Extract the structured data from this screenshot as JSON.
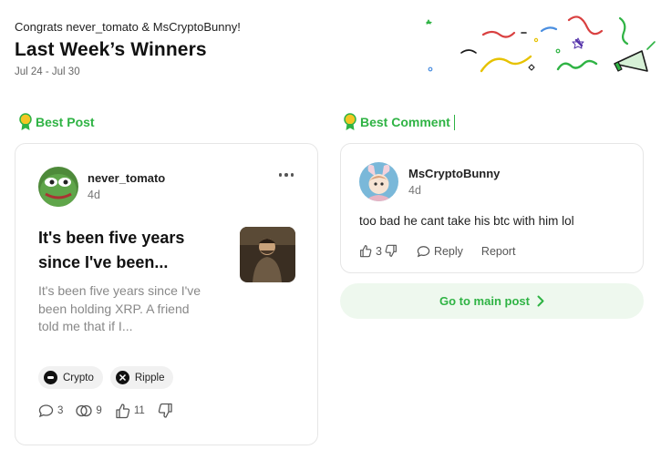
{
  "header": {
    "congrats": "Congrats never_tomato & MsCryptoBunny!",
    "title": "Last Week’s Winners",
    "date_range": "Jul 24 - Jul 30"
  },
  "best_post": {
    "section_label": "Best Post",
    "username": "never_tomato",
    "time": "4d",
    "title": "It's been five years since I've been...",
    "excerpt": "It's been five years since I've been holding XRP. A friend told me that if I...",
    "tags": [
      {
        "label": "Crypto",
        "icon": "crypto-icon"
      },
      {
        "label": "Ripple",
        "icon": "ripple-x-icon"
      }
    ],
    "stats": {
      "comments": "3",
      "reactions": "9",
      "likes": "11"
    }
  },
  "best_comment": {
    "section_label": "Best Comment",
    "username": "MsCryptoBunny",
    "time": "4d",
    "text": "too bad he cant take his btc with him lol",
    "likes": "3",
    "reply_label": "Reply",
    "report_label": "Report"
  },
  "goto_button": {
    "label": "Go to main post"
  },
  "colors": {
    "accent_green": "#2fb344",
    "button_bg": "#eef8ee",
    "muted_text": "#888888"
  }
}
